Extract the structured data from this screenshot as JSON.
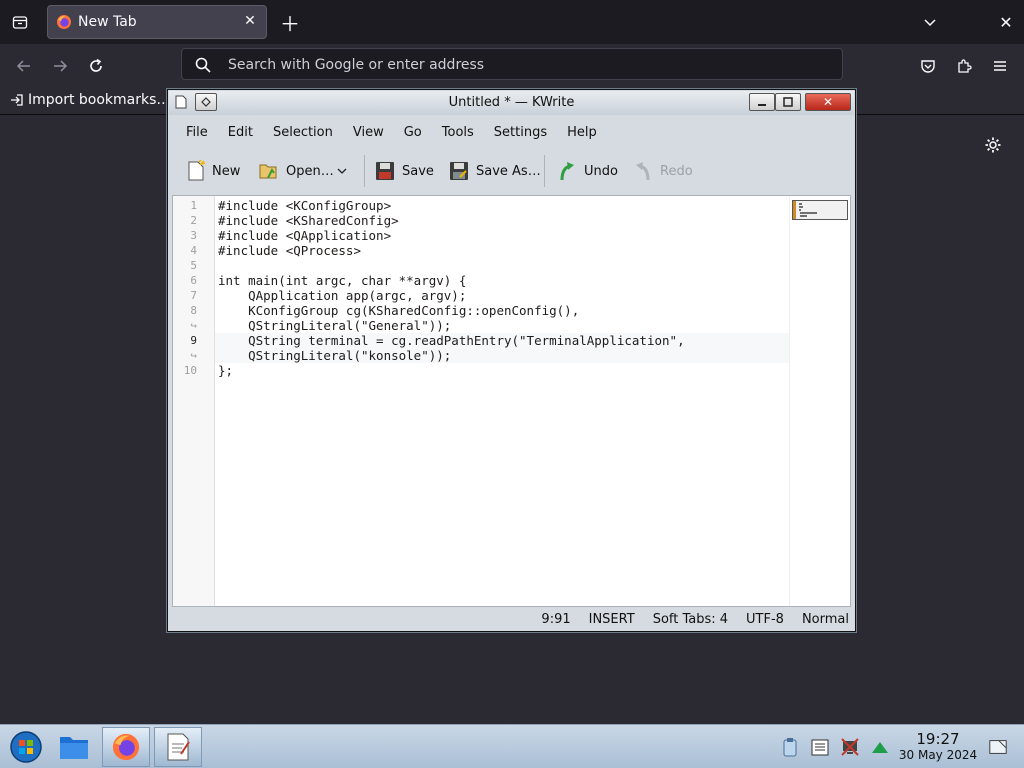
{
  "browser": {
    "tab_title": "New Tab",
    "search_placeholder": "Search with Google or enter address",
    "bookmark_import_label": "Import bookmarks…"
  },
  "kwrite": {
    "window_title": "Untitled * — KWrite",
    "menu": [
      "File",
      "Edit",
      "Selection",
      "View",
      "Go",
      "Tools",
      "Settings",
      "Help"
    ],
    "toolbar": {
      "new": "New",
      "open": "Open…",
      "save": "Save",
      "save_as": "Save As…",
      "undo": "Undo",
      "redo": "Redo"
    },
    "gutter": [
      "1",
      "2",
      "3",
      "4",
      "5",
      "6",
      "7",
      "8",
      "↪",
      "9",
      "↪",
      "10"
    ],
    "code_lines": [
      "#include <KConfigGroup>",
      "#include <KSharedConfig>",
      "#include <QApplication>",
      "#include <QProcess>",
      "",
      "int main(int argc, char **argv) {",
      "    QApplication app(argc, argv);",
      "    KConfigGroup cg(KSharedConfig::openConfig(),",
      "    QStringLiteral(\"General\"));",
      "    QString terminal = cg.readPathEntry(\"TerminalApplication\",",
      "    QStringLiteral(\"konsole\"));",
      "};"
    ],
    "status": {
      "position": "9:91",
      "mode": "INSERT",
      "indent": "Soft Tabs: 4",
      "encoding": "UTF-8",
      "input_mode": "Normal"
    }
  },
  "taskbar": {
    "time": "19:27",
    "date": "30 May 2024"
  },
  "colors": {
    "browser_bg": "#2b2a33",
    "tabstrip_bg": "#1c1b22",
    "kwrite_chrome": "#d6dbe1",
    "taskbar": "#b9cadc"
  }
}
